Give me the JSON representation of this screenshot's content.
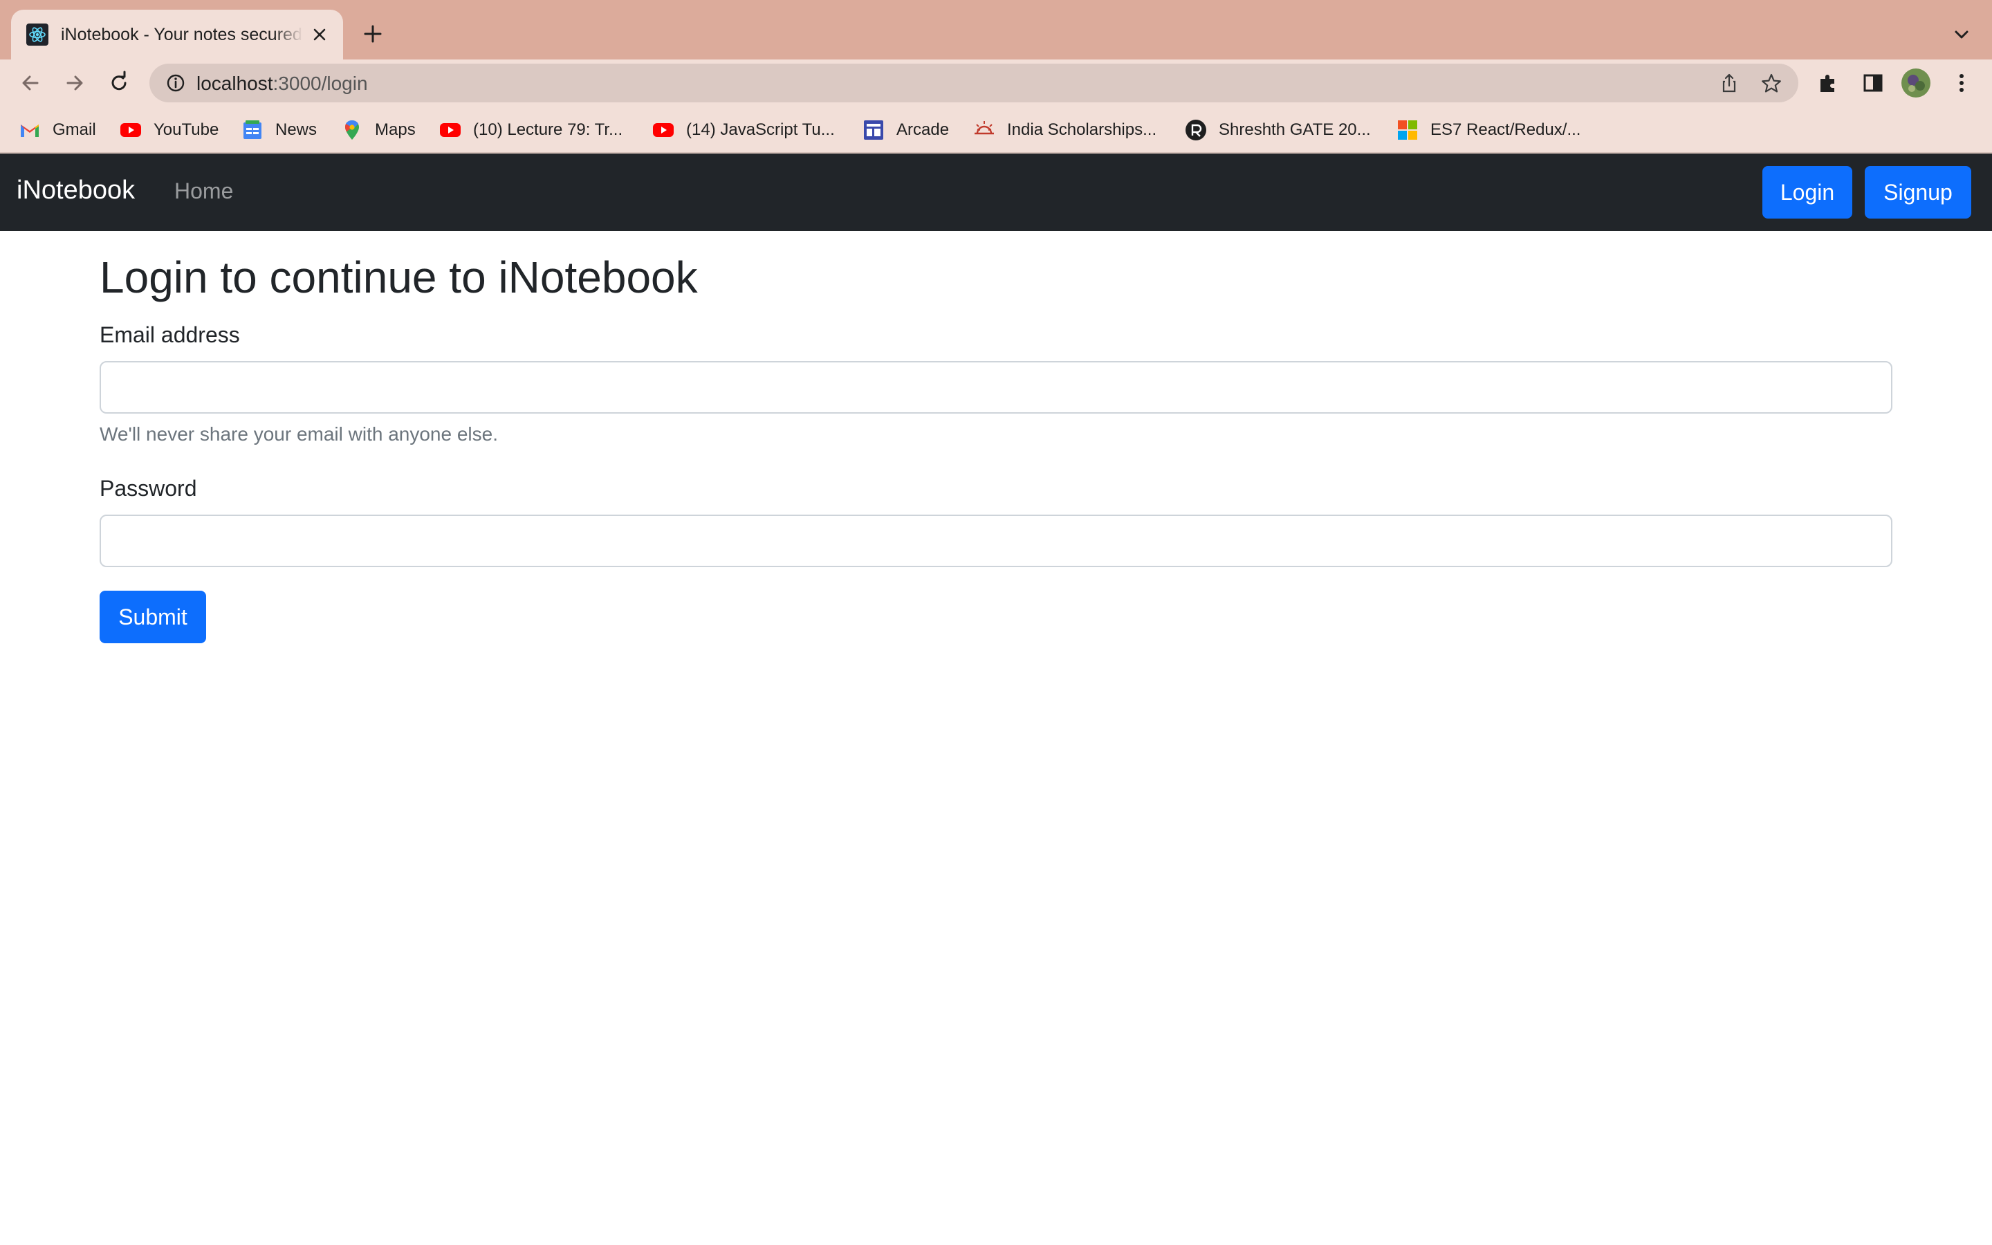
{
  "browser": {
    "tab_title": "iNotebook - Your notes secured on the cloud",
    "url_host": "localhost",
    "url_path": ":3000/login",
    "bookmarks": [
      {
        "label": "Gmail",
        "icon": "gmail-icon"
      },
      {
        "label": "YouTube",
        "icon": "youtube-icon"
      },
      {
        "label": "News",
        "icon": "google-news-icon"
      },
      {
        "label": "Maps",
        "icon": "maps-pin-icon"
      },
      {
        "label": "(10) Lecture 79: Tr...",
        "icon": "youtube-icon"
      },
      {
        "label": "(14) JavaScript Tu...",
        "icon": "youtube-icon"
      },
      {
        "label": "Arcade",
        "icon": "arcade-icon"
      },
      {
        "label": "India Scholarships...",
        "icon": "scholarship-icon"
      },
      {
        "label": "Shreshth GATE 20...",
        "icon": "gate-logo-icon"
      },
      {
        "label": "ES7 React/Redux/...",
        "icon": "microsoft-icon"
      }
    ]
  },
  "navbar": {
    "brand": "iNotebook",
    "home": "Home",
    "login": "Login",
    "signup": "Signup"
  },
  "form": {
    "heading": "Login to continue to iNotebook",
    "email_label": "Email address",
    "email_value": "",
    "email_help": "We'll never share your email with anyone else.",
    "password_label": "Password",
    "password_value": "",
    "submit": "Submit"
  },
  "colors": {
    "tabstrip": "#dcab9b",
    "toolbar": "#f2dfd8",
    "navbar": "#212529",
    "primary": "#0d6efd"
  }
}
